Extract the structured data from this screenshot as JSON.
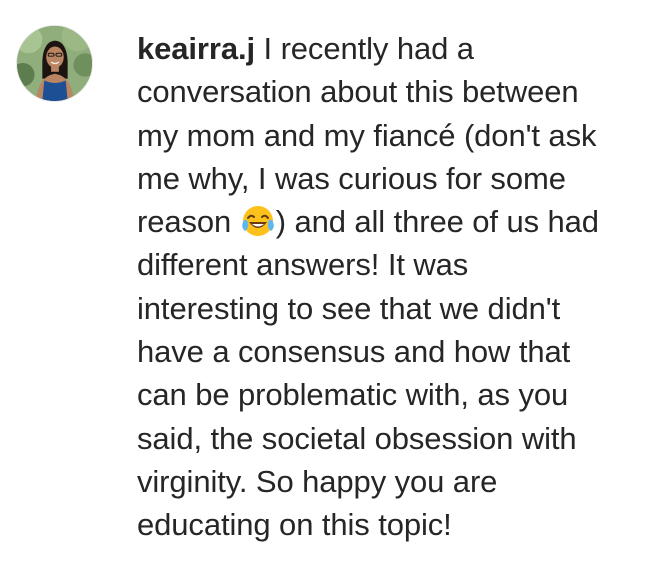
{
  "comment": {
    "username": "keairra.j",
    "lines": [
      "I recently had a",
      "conversation about this between",
      "my mom and my fiancé (don't ask",
      "me why, I was curious for some",
      "reason",
      ") and all three of us had",
      "different answers! It was",
      "interesting to see that we didn't",
      "have a consensus and how that",
      "can be problematic with, as you",
      "said, the societal obsession with",
      "virginity. So happy you are",
      "educating on this topic!"
    ],
    "emoji": "face-with-tears-of-joy-icon",
    "avatar": "user-avatar"
  },
  "colors": {
    "text": "#262626",
    "background": "#ffffff"
  }
}
